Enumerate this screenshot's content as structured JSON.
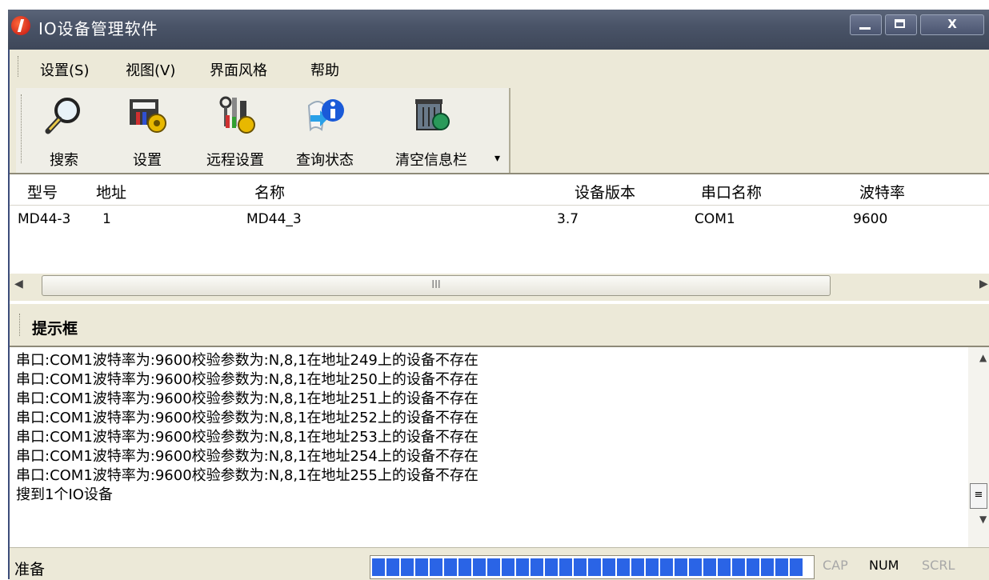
{
  "window": {
    "title": "IO设备管理软件",
    "close_label": "X"
  },
  "menu": [
    "设置(S)",
    "视图(V)",
    "界面风格",
    "帮助"
  ],
  "toolbar": {
    "buttons": [
      {
        "label": "搜索",
        "icon": "search-magnifier-icon"
      },
      {
        "label": "设置",
        "icon": "settings-icon"
      },
      {
        "label": "远程设置",
        "icon": "remote-settings-icon"
      },
      {
        "label": "查询状态",
        "icon": "info-icon"
      },
      {
        "label": "清空信息栏",
        "icon": "recycle-bin-icon"
      }
    ],
    "overflow": "▾"
  },
  "device_table": {
    "columns": [
      "型号",
      "地址",
      "名称",
      "设备版本",
      "串口名称",
      "波特率"
    ],
    "rows": [
      [
        "MD44-3",
        "1",
        "MD44_3",
        "3.7",
        "COM1",
        "9600"
      ]
    ]
  },
  "hscroll": {
    "thumb_label": "III"
  },
  "hint_panel": {
    "title": "提示框",
    "lines": [
      "串口:COM1波特率为:9600校验参数为:N,8,1在地址249上的设备不存在",
      "串口:COM1波特率为:9600校验参数为:N,8,1在地址250上的设备不存在",
      "串口:COM1波特率为:9600校验参数为:N,8,1在地址251上的设备不存在",
      "串口:COM1波特率为:9600校验参数为:N,8,1在地址252上的设备不存在",
      "串口:COM1波特率为:9600校验参数为:N,8,1在地址253上的设备不存在",
      "串口:COM1波特率为:9600校验参数为:N,8,1在地址254上的设备不存在",
      "串口:COM1波特率为:9600校验参数为:N,8,1在地址255上的设备不存在",
      "搜到1个IO设备"
    ]
  },
  "status_bar": {
    "text": "准备",
    "progress_fraction": 1.0,
    "indicators": [
      {
        "label": "CAP",
        "active": false
      },
      {
        "label": "NUM",
        "active": true
      },
      {
        "label": "SCRL",
        "active": false
      }
    ]
  },
  "colors": {
    "progress_fill": "#2a64e6",
    "titlebar": "#4a5468",
    "chrome": "#ece9d8"
  }
}
